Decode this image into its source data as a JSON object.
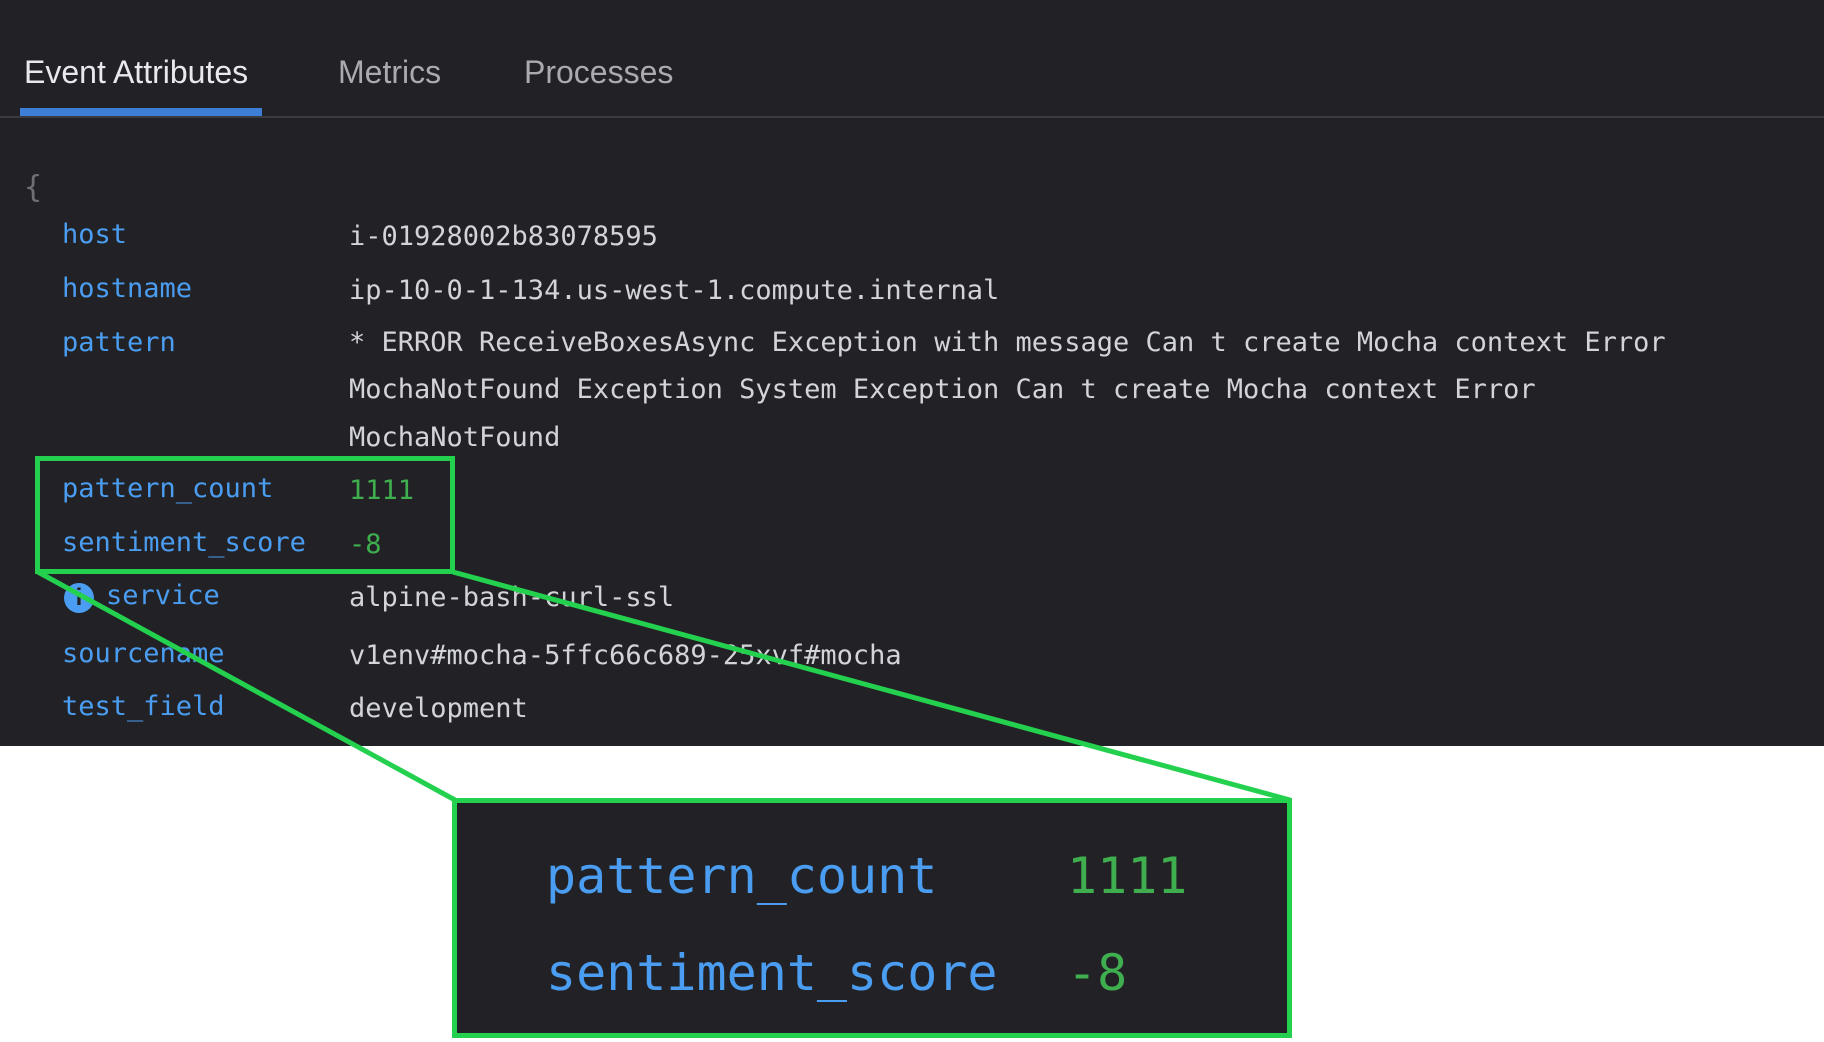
{
  "tabs": [
    {
      "label": "Event Attributes",
      "active": true
    },
    {
      "label": "Metrics",
      "active": false
    },
    {
      "label": "Processes",
      "active": false
    }
  ],
  "json_view": {
    "open_brace": "{",
    "rows": [
      {
        "key": "host",
        "value": "i-01928002b83078595"
      },
      {
        "key": "hostname",
        "value": "ip-10-0-1-134.us-west-1.compute.internal"
      },
      {
        "key": "pattern",
        "value_lines": [
          "* ERROR ReceiveBoxesAsync Exception with message Can t create Mocha context Error",
          "MochaNotFound Exception System Exception Can t create Mocha context Error",
          "MochaNotFound"
        ]
      },
      {
        "key": "pattern_count",
        "value": "1111"
      },
      {
        "key": "sentiment_score",
        "value": "-8"
      },
      {
        "key": "service",
        "value": "alpine-bash-curl-ssl",
        "icon": "info-icon"
      },
      {
        "key": "sourcename",
        "value": "v1env#mocha-5ffc66c689-25xvf#mocha"
      },
      {
        "key": "test_field",
        "value": "development"
      }
    ]
  },
  "zoom": {
    "rows": [
      {
        "key": "pattern_count",
        "value": "1111"
      },
      {
        "key": "sentiment_score",
        "value": "-8"
      }
    ]
  },
  "colors": {
    "panel_bg": "#222226",
    "key": "#4a9df0",
    "value": "#d3d4d7",
    "number": "#3fae4e",
    "highlight": "#23d14f",
    "tab_underline": "#3d7fd6"
  }
}
